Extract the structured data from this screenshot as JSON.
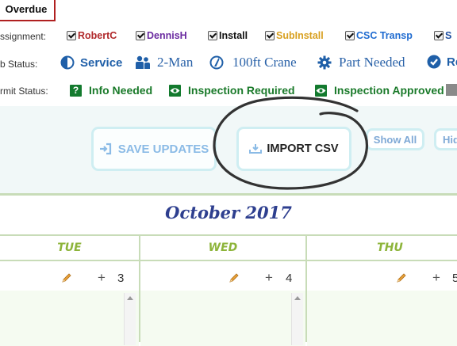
{
  "filters": {
    "overdue_tab": "Overdue",
    "assignment": {
      "label": "ssignment:",
      "items": [
        {
          "label": "RobertC",
          "color": "#b0282a"
        },
        {
          "label": "DennisH",
          "color": "#6a2aa0"
        },
        {
          "label": "Install",
          "color": "#111111"
        },
        {
          "label": "SubInstall",
          "color": "#d8a020"
        },
        {
          "label": "CSC Transp",
          "color": "#1f6bd0"
        },
        {
          "label": "S",
          "color": "#1f4fa0"
        }
      ]
    },
    "job_status": {
      "label": "b Status:",
      "items": [
        {
          "label": "Service",
          "icon": "half-circle-icon"
        },
        {
          "label": "2-Man",
          "icon": "two-people-icon"
        },
        {
          "label": "100ft Crane",
          "icon": "crane-icon"
        },
        {
          "label": "Part Needed",
          "icon": "gear-icon"
        },
        {
          "label": "Re",
          "icon": "check-circle-icon"
        }
      ]
    },
    "permit_status": {
      "label": "rmit Status:",
      "items": [
        {
          "label": "Info Needed",
          "icon": "question-icon",
          "glyph": "?"
        },
        {
          "label": "Inspection Required",
          "icon": "eye-icon"
        },
        {
          "label": "Inspection Approved",
          "icon": "eye-icon"
        }
      ]
    }
  },
  "toolbar": {
    "save_label": "SAVE UPDATES",
    "import_label": "IMPORT CSV",
    "show_all_label": "Show All",
    "hide_label": "Hid"
  },
  "calendar": {
    "month_title": "October 2017",
    "days": [
      {
        "label": "TUE",
        "number": "3"
      },
      {
        "label": "WED",
        "number": "4"
      },
      {
        "label": "THU",
        "number": "5"
      }
    ]
  }
}
